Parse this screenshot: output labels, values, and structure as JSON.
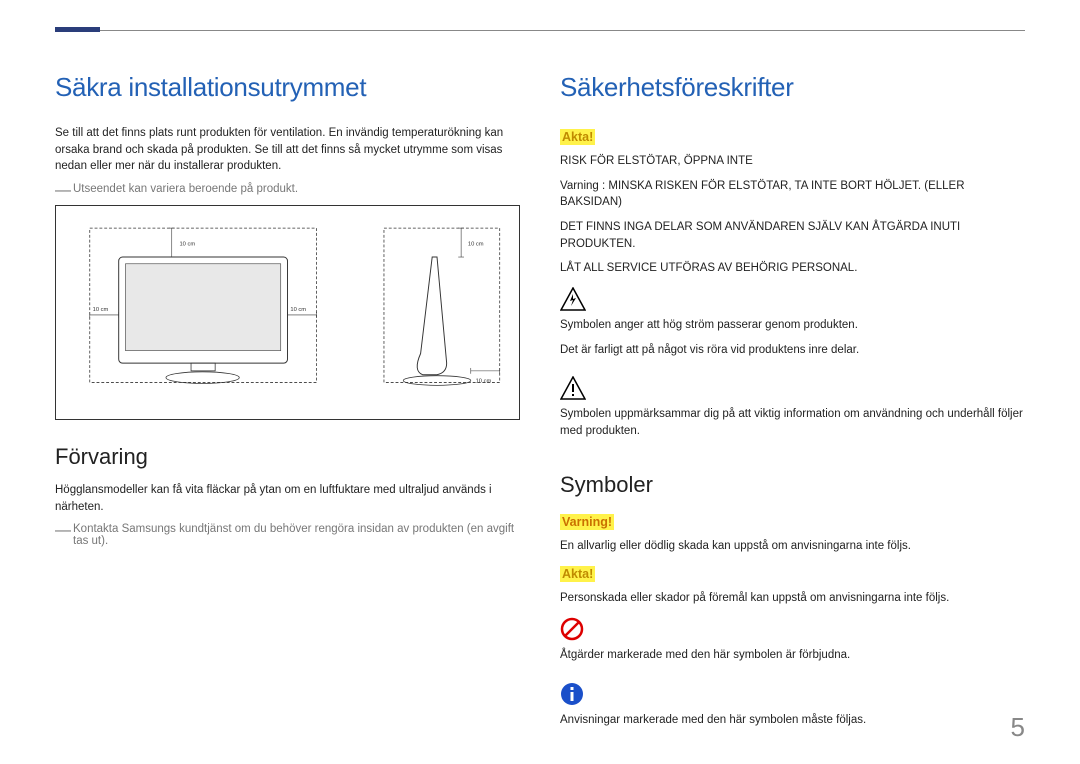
{
  "pageNumber": "5",
  "left": {
    "heading1": "Säkra installationsutrymmet",
    "intro": "Se till att det finns plats runt produkten för ventilation. En invändig temperaturökning kan orsaka brand och skada på produkten. Se till att det finns så mycket utrymme som visas nedan eller mer när du installerar produkten.",
    "note1": "Utseendet kan variera beroende på produkt.",
    "dim1": "10 cm",
    "dim2": "10 cm",
    "dim3": "10 cm",
    "dim4": "10 cm",
    "dim5": "10 cm",
    "heading2": "Förvaring",
    "body2": "Högglansmodeller kan få vita fläckar på ytan om en luftfuktare med ultraljud används i närheten.",
    "note2": "Kontakta Samsungs kundtjänst om du behöver rengöra insidan av produkten (en avgift tas ut)."
  },
  "right": {
    "heading1": "Säkerhetsföreskrifter",
    "aktaLabel": "Akta!",
    "risk1": "RISK FÖR ELSTÖTAR, ÖPPNA INTE",
    "risk2": "Varning : MINSKA RISKEN FÖR ELSTÖTAR, TA INTE BORT HÖLJET. (ELLER BAKSIDAN)",
    "risk3": "DET FINNS INGA DELAR SOM ANVÄNDAREN SJÄLV KAN ÅTGÄRDA INUTI PRODUKTEN.",
    "risk4": "LÅT ALL SERVICE UTFÖRAS AV BEHÖRIG PERSONAL.",
    "bolt1": "Symbolen anger att hög ström passerar genom produkten.",
    "bolt2": "Det är farligt att på något vis röra vid produktens inre delar.",
    "excl1": "Symbolen uppmärksammar dig på att viktig information om användning och underhåll följer med produkten.",
    "heading2": "Symboler",
    "varningLabel": "Varning!",
    "varningText": "En allvarlig eller dödlig skada kan uppstå om anvisningarna inte följs.",
    "aktaLabel2": "Akta!",
    "aktaText": "Personskada eller skador på föremål kan uppstå om anvisningarna inte följs.",
    "prohibitText": "Åtgärder markerade med den här symbolen är förbjudna.",
    "infoText": "Anvisningar markerade med den här symbolen måste följas."
  }
}
